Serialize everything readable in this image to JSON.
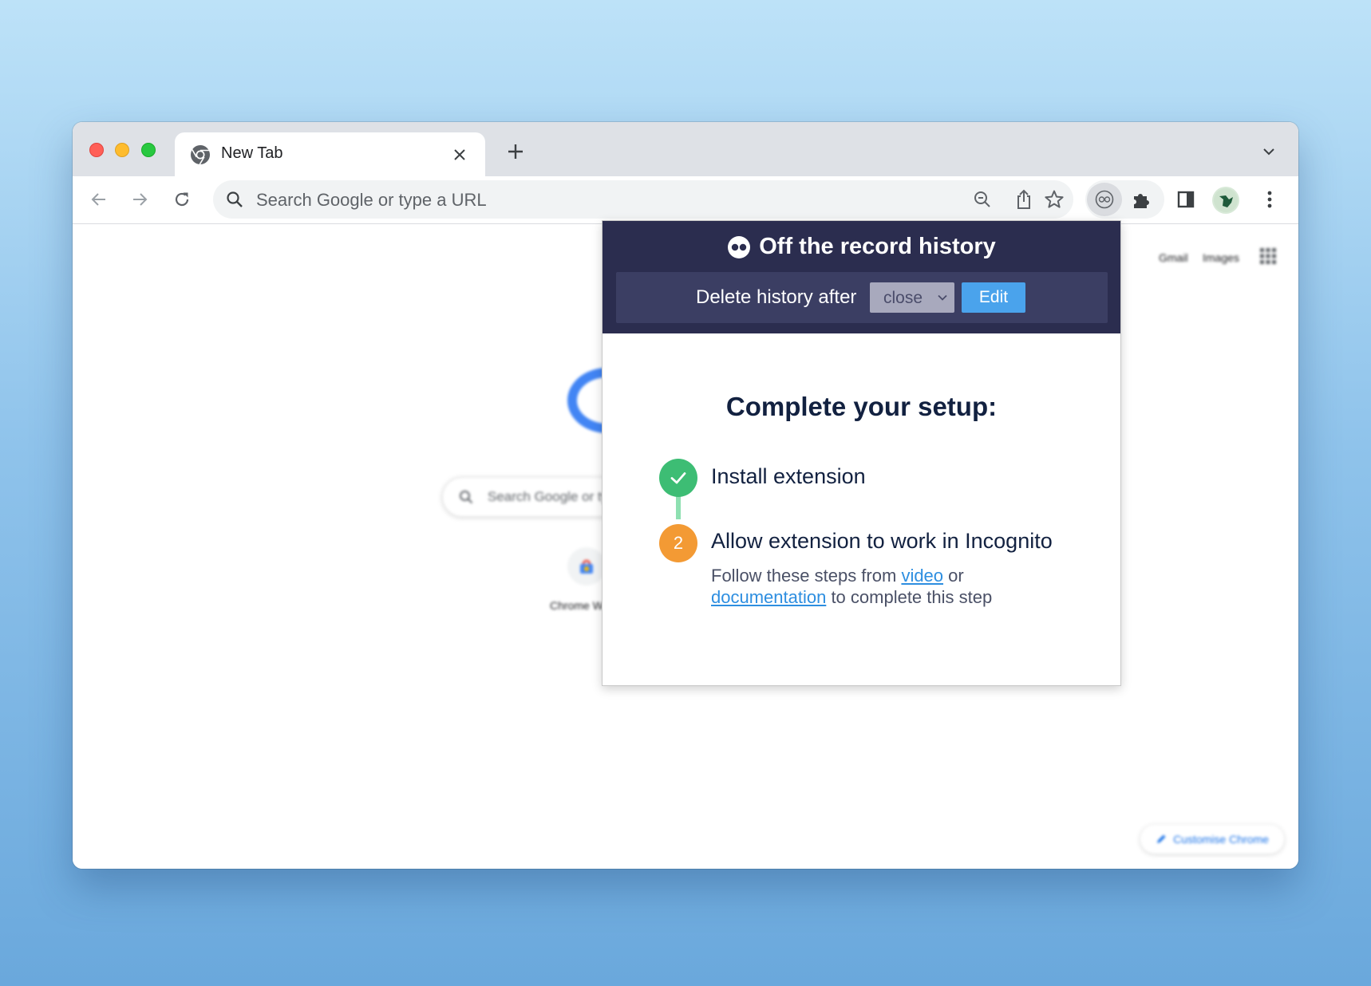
{
  "tab": {
    "title": "New Tab"
  },
  "omnibox": {
    "placeholder": "Search Google or type a URL"
  },
  "ntp": {
    "links": [
      "Gmail",
      "Images"
    ],
    "search_placeholder": "Search Google or type a URL",
    "shortcut_label": "Chrome Web Store",
    "customize_label": "Customise Chrome"
  },
  "popup": {
    "title": "Off the record history",
    "setting_label": "Delete history after",
    "select_value": "close",
    "edit_label": "Edit",
    "setup_heading": "Complete your setup:",
    "steps": [
      {
        "number": "",
        "title": "Install extension",
        "status": "done"
      },
      {
        "number": "2",
        "title": "Allow extension to work in Incognito",
        "status": "pending"
      }
    ],
    "step2_desc": {
      "text1": "Follow these steps from ",
      "link1": "video",
      "text2": " or ",
      "link2": "documentation",
      "text3": " to complete this step"
    }
  },
  "colors": {
    "popup_header": "#2b2d4f",
    "popup_setting_bar": "#3b3e63",
    "edit_button": "#4aa3ec",
    "step_done": "#3dbd74",
    "step_pending": "#f39a34",
    "link": "#2d8ee0"
  }
}
